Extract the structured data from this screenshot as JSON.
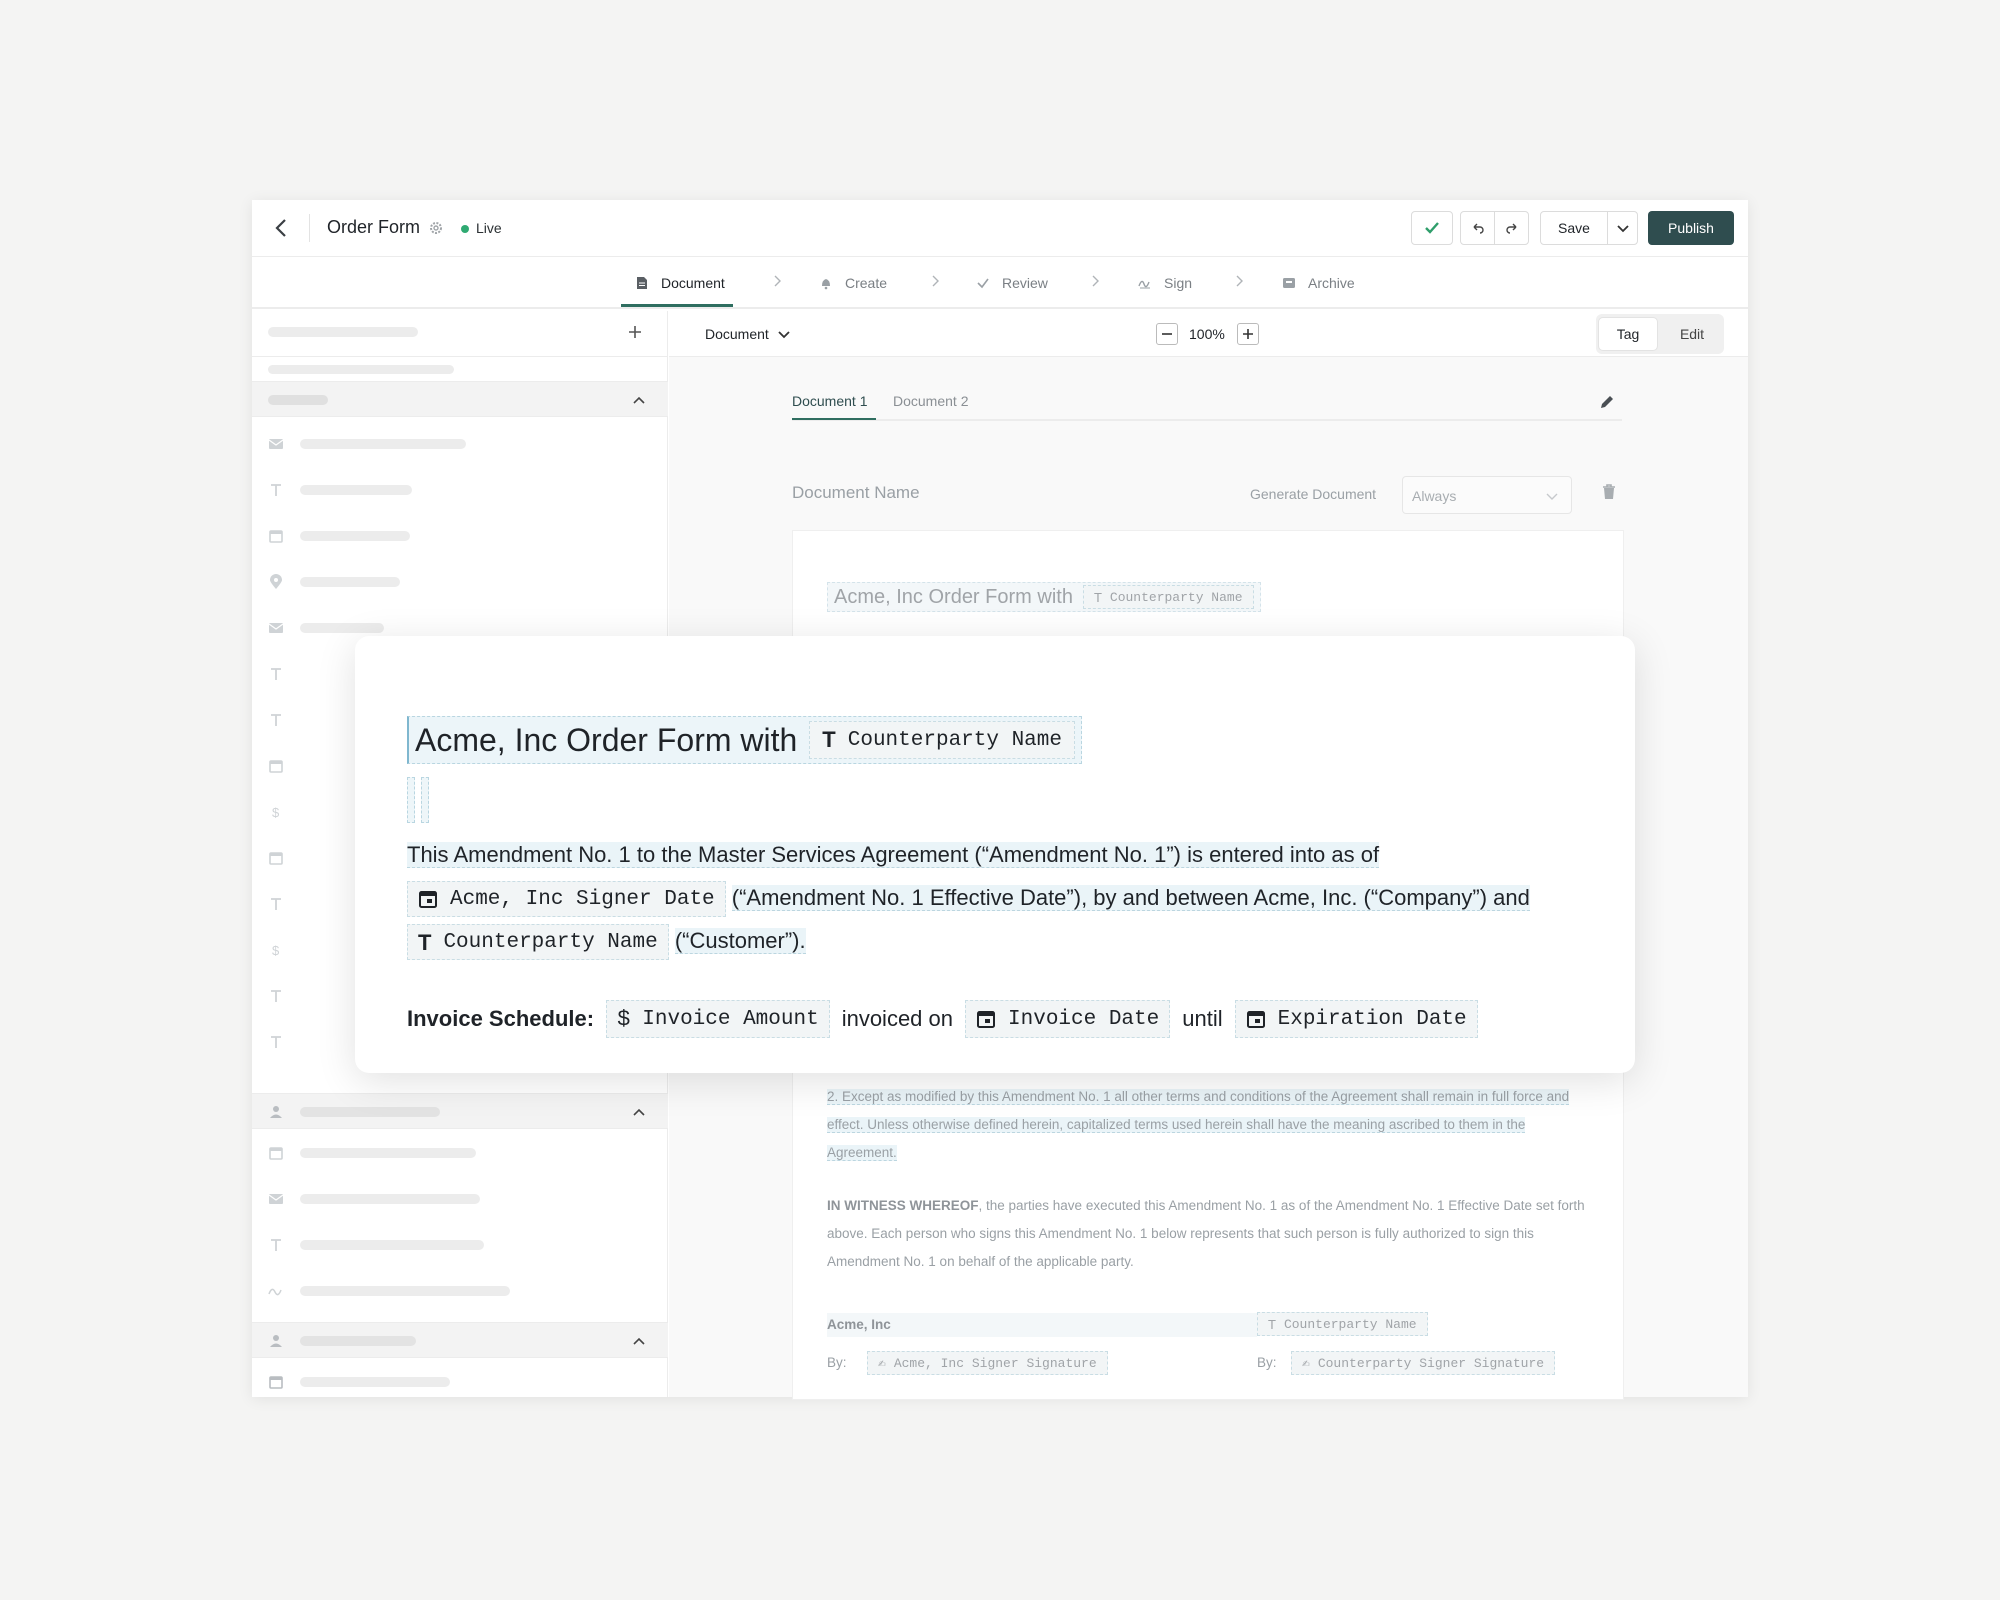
{
  "header": {
    "title": "Order Form",
    "status": "Live",
    "save_label": "Save",
    "publish_label": "Publish",
    "status_color": "#2faa72",
    "brand_color": "#2f4d4f"
  },
  "steps": [
    {
      "label": "Document",
      "icon": "document-icon"
    },
    {
      "label": "Create",
      "icon": "bell-icon"
    },
    {
      "label": "Review",
      "icon": "check-icon"
    },
    {
      "label": "Sign",
      "icon": "signature-icon"
    },
    {
      "label": "Archive",
      "icon": "archive-icon"
    }
  ],
  "toolbar": {
    "document_dropdown": "Document",
    "zoom": "100%",
    "tag_label": "Tag",
    "edit_label": "Edit"
  },
  "doc_tabs": [
    "Document 1",
    "Document 2"
  ],
  "doc_settings": {
    "name_label": "Document Name",
    "generate_label": "Generate Document",
    "generate_value": "Always"
  },
  "background_doc": {
    "title_text": "Acme, Inc Order Form with",
    "title_field": "Counterparty Name",
    "p2": "2. Except as modified by this Amendment No. 1 all other terms and conditions of the Agreement shall remain in full force and effect. Unless otherwise defined herein, capitalized terms used herein shall have the meaning ascribed to them in the Agreement.",
    "witness_bold": "IN WITNESS WHEREOF",
    "witness_rest": ", the parties have executed this Amendment No. 1 as of the Amendment No. 1 Effective Date set forth above. Each person who signs this Amendment No. 1 below represents that such person is fully authorized to sign this Amendment No. 1 on behalf of the applicable party.",
    "party_left": "Acme, Inc",
    "party_right_field": "Counterparty Name",
    "by_label": "By:",
    "sig_left": "Acme, Inc Signer Signature",
    "sig_right": "Counterparty Signer Signature"
  },
  "overlay": {
    "title_text": "Acme, Inc Order Form with",
    "title_field": "Counterparty Name",
    "p1_a": "This Amendment No. 1 to the Master Services Agreement (“Amendment No. 1”) is entered into as of",
    "p1_field1": "Acme, Inc Signer Date",
    "p1_b": "(“Amendment No. 1 Effective Date”), by and between Acme, Inc. (“Company”) and",
    "p1_field2": "Counterparty Name",
    "p1_c": "(“Customer”).",
    "inv_label": "Invoice Schedule:",
    "inv_field1": "Invoice Amount",
    "inv_mid": "invoiced on",
    "inv_field2": "Invoice Date",
    "inv_until": "until",
    "inv_field3": "Expiration Date"
  }
}
